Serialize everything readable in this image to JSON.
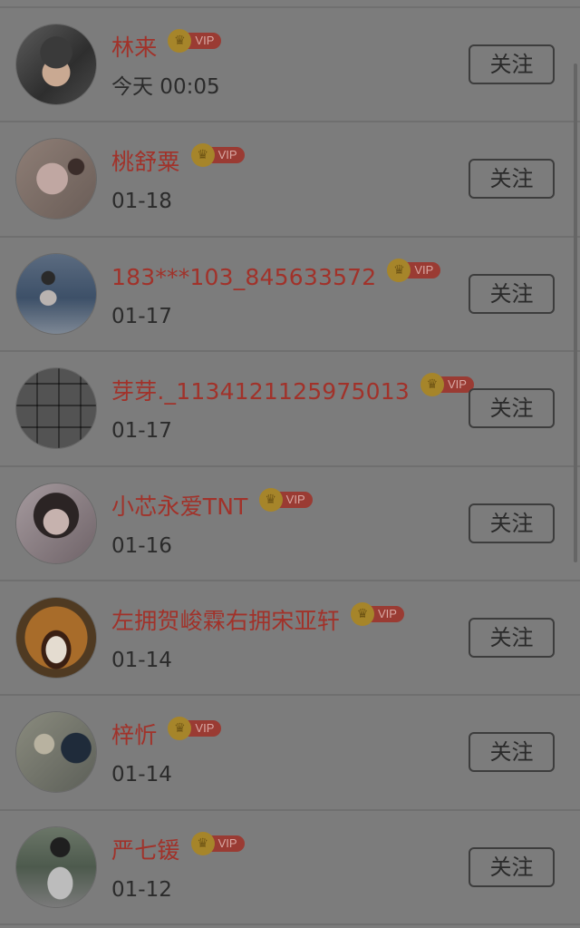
{
  "follow_label": "关注",
  "vip_label": "VIP",
  "colors": {
    "name": "#a1322a",
    "vip_badge": "#9a3b33",
    "crown": "#a6852a",
    "background": "#7c7c7c"
  },
  "users": [
    {
      "name": "林来",
      "time": "今天 00:05",
      "avatar": "avatar-boy-headphones",
      "vip": true
    },
    {
      "name": "桃舒粟",
      "time": "01-18",
      "avatar": "avatar-cartoon-bunny",
      "vip": true
    },
    {
      "name": "183***103_845633572",
      "time": "01-17",
      "avatar": "avatar-girl-sea",
      "vip": true
    },
    {
      "name": "芽芽._1134121125975013",
      "time": "01-17",
      "avatar": "avatar-photo-grid",
      "vip": true
    },
    {
      "name": "小芯永爱TNT",
      "time": "01-16",
      "avatar": "avatar-girl-portrait",
      "vip": true
    },
    {
      "name": "左拥贺峻霖右拥宋亚轩",
      "time": "01-14",
      "avatar": "avatar-cartoon-bear",
      "vip": true
    },
    {
      "name": "梓忻",
      "time": "01-14",
      "avatar": "avatar-girl-room",
      "vip": true
    },
    {
      "name": "严七锾",
      "time": "01-12",
      "avatar": "avatar-girl-back",
      "vip": true
    }
  ]
}
